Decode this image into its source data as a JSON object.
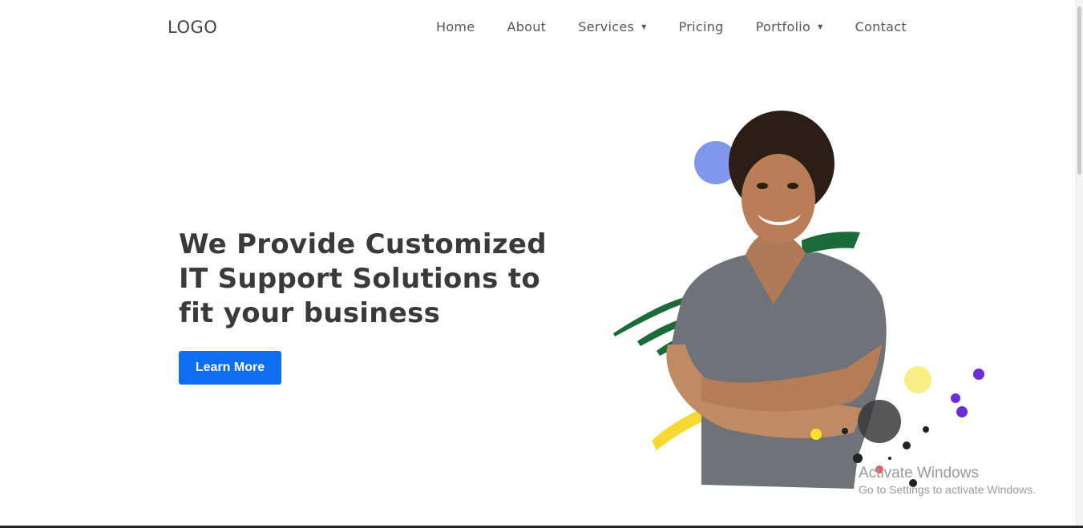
{
  "header": {
    "logo": "LOGO",
    "nav": [
      {
        "label": "Home",
        "dropdown": false
      },
      {
        "label": "About",
        "dropdown": false
      },
      {
        "label": "Services",
        "dropdown": true
      },
      {
        "label": "Pricing",
        "dropdown": false
      },
      {
        "label": "Portfolio",
        "dropdown": true
      },
      {
        "label": "Contact",
        "dropdown": false
      }
    ]
  },
  "hero": {
    "title_line1": "We Provide Customized",
    "title_line2": "IT Support Solutions to",
    "title_line3": "fit your business",
    "cta_label": "Learn More",
    "cta_color": "#0d6ef2"
  },
  "os_watermark": {
    "title": "Activate Windows",
    "subtitle": "Go to Settings to activate Windows."
  }
}
